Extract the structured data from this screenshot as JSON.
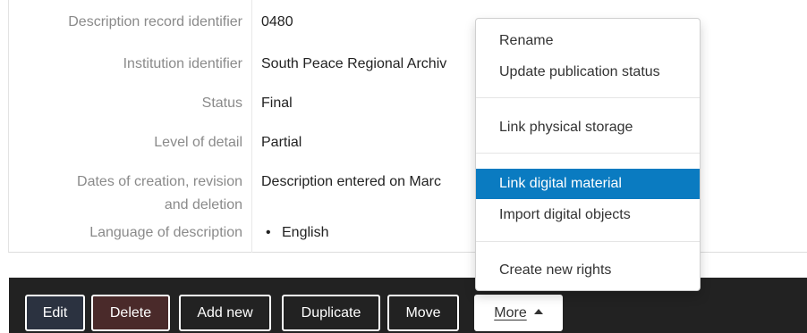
{
  "record": {
    "fields": [
      {
        "label": "Description record identifier",
        "value": "0480"
      },
      {
        "label": "Institution identifier",
        "value": "South Peace Regional Archiv"
      },
      {
        "label": "Status",
        "value": "Final"
      },
      {
        "label": "Level of detail",
        "value": "Partial"
      },
      {
        "label_line1": "Dates of creation, revision",
        "label_line2": "and deletion",
        "value": "Description entered on Marc"
      },
      {
        "label": "Language of description",
        "items": [
          "English"
        ]
      }
    ]
  },
  "actions": {
    "edit": "Edit",
    "delete": "Delete",
    "add_new": "Add new",
    "duplicate": "Duplicate",
    "move": "Move",
    "more": "More"
  },
  "more_menu": {
    "items": [
      "Rename",
      "Update publication status",
      "Link physical storage",
      "Link digital material",
      "Import digital objects",
      "Create new rights"
    ],
    "highlighted": "Link digital material",
    "highlight_color": "#0a7bc1"
  }
}
